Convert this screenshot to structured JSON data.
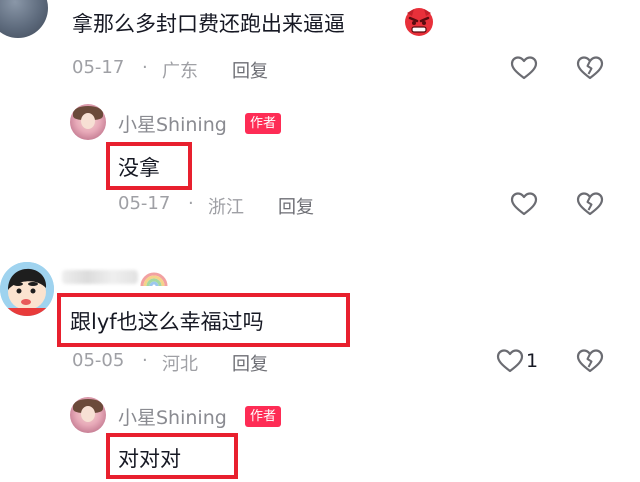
{
  "comment1": {
    "text": "拿那么多封口费还跑出来逼逼",
    "date": "05-17",
    "sep": "·",
    "location": "广东",
    "reply_label": "回复"
  },
  "reply1": {
    "username": "小星Shining",
    "badge": "作者",
    "text": "没拿",
    "date": "05-17",
    "sep": "·",
    "location": "浙江",
    "reply_label": "回复"
  },
  "comment2": {
    "text": "跟lyf也这么幸福过吗",
    "date": "05-05",
    "sep": "·",
    "location": "河北",
    "reply_label": "回复",
    "like_count": "1"
  },
  "reply2": {
    "username": "小星Shining",
    "badge": "作者",
    "text": "对对对"
  },
  "icons": {
    "like": "heart-outline-icon",
    "dislike": "broken-heart-icon",
    "angry_emoji": "angry-face-emoji",
    "rainbow": "rainbow-emoji"
  },
  "colors": {
    "highlight_box": "#e8202e",
    "author_badge": "#fe2c55",
    "meta_text": "#9fa0a5"
  }
}
